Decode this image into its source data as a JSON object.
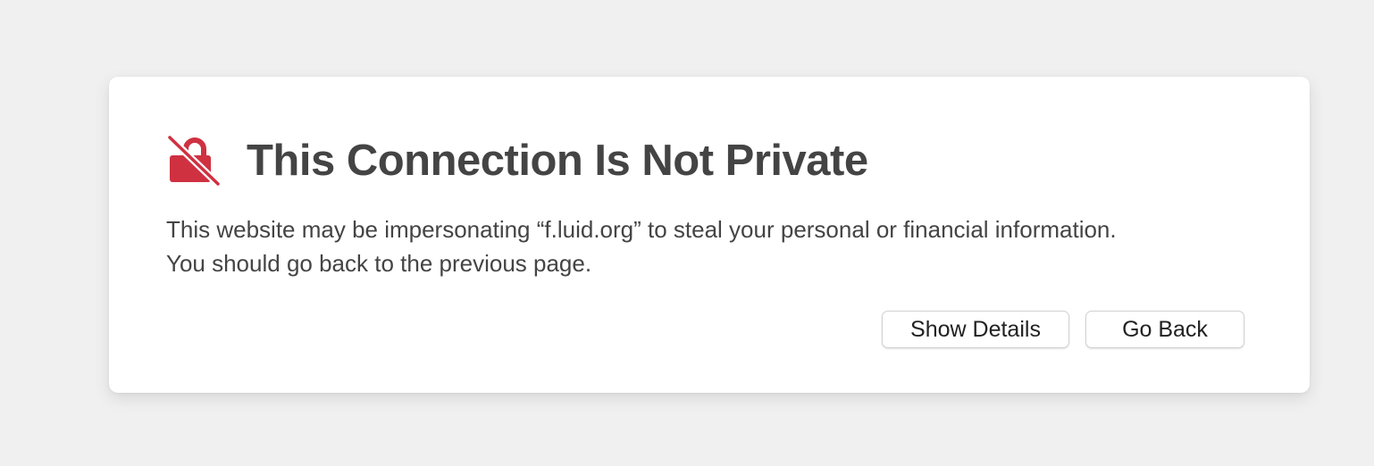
{
  "colors": {
    "background": "#f0f0f0",
    "card": "#ffffff",
    "title": "#444444",
    "text": "#444444",
    "warning_icon": "#cf3141"
  },
  "dialog": {
    "icon": "lock-slash-icon",
    "title": "This Connection Is Not Private",
    "message_line1": "This website may be impersonating “f.luid.org” to steal your personal or financial information.",
    "message_line2": "You should go back to the previous page."
  },
  "actions": {
    "show_details_label": "Show Details",
    "go_back_label": "Go Back"
  }
}
